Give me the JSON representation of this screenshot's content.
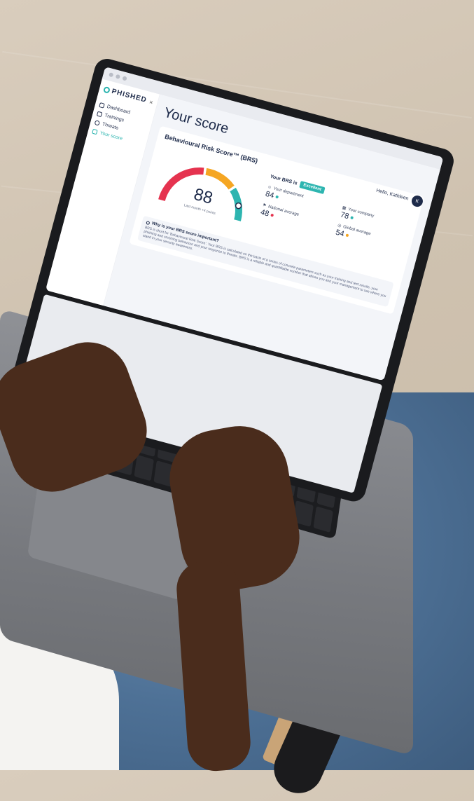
{
  "app": {
    "logo": "PHISHED",
    "close_label": "×"
  },
  "sidebar": {
    "items": [
      {
        "label": "Dashboard",
        "icon": "dashboard-icon"
      },
      {
        "label": "Trainings",
        "icon": "trainings-icon"
      },
      {
        "label": "Threats",
        "icon": "threats-icon"
      },
      {
        "label": "Your score",
        "icon": "trophy-icon"
      }
    ]
  },
  "header": {
    "title": "Your score",
    "greeting": "Hello, Kathleen",
    "avatar_initial": "K"
  },
  "brs_card": {
    "title": "Behavioural Risk Score™ (BRS)",
    "score": "88",
    "score_caption": "Last month +4 points",
    "brs_status_label": "Your BRS is",
    "brs_status": "Excellent",
    "stats": [
      {
        "label": "Your department",
        "value": "84",
        "color": "#2db5b0"
      },
      {
        "label": "Your company",
        "value": "78",
        "color": "#2db5b0"
      },
      {
        "label": "National average",
        "value": "48",
        "color": "#e5334f"
      },
      {
        "label": "Global average",
        "value": "54",
        "color": "#f5a623"
      }
    ],
    "gauge_level": 0.88,
    "gauge_colors": [
      "#e5334f",
      "#f5a623",
      "#2db5b0"
    ]
  },
  "info": {
    "title": "Why is your BRS score important?",
    "body": "BRS is short for 'Behavioural Risk Score'. Your BRS is calculated on the basis of a series of concrete parameters such as your training and test results, your phishing and smishing behaviour and your response to threats. BRS is a reliable and quantifiable number that allows you and your management to see where you stand in your security awareness."
  }
}
